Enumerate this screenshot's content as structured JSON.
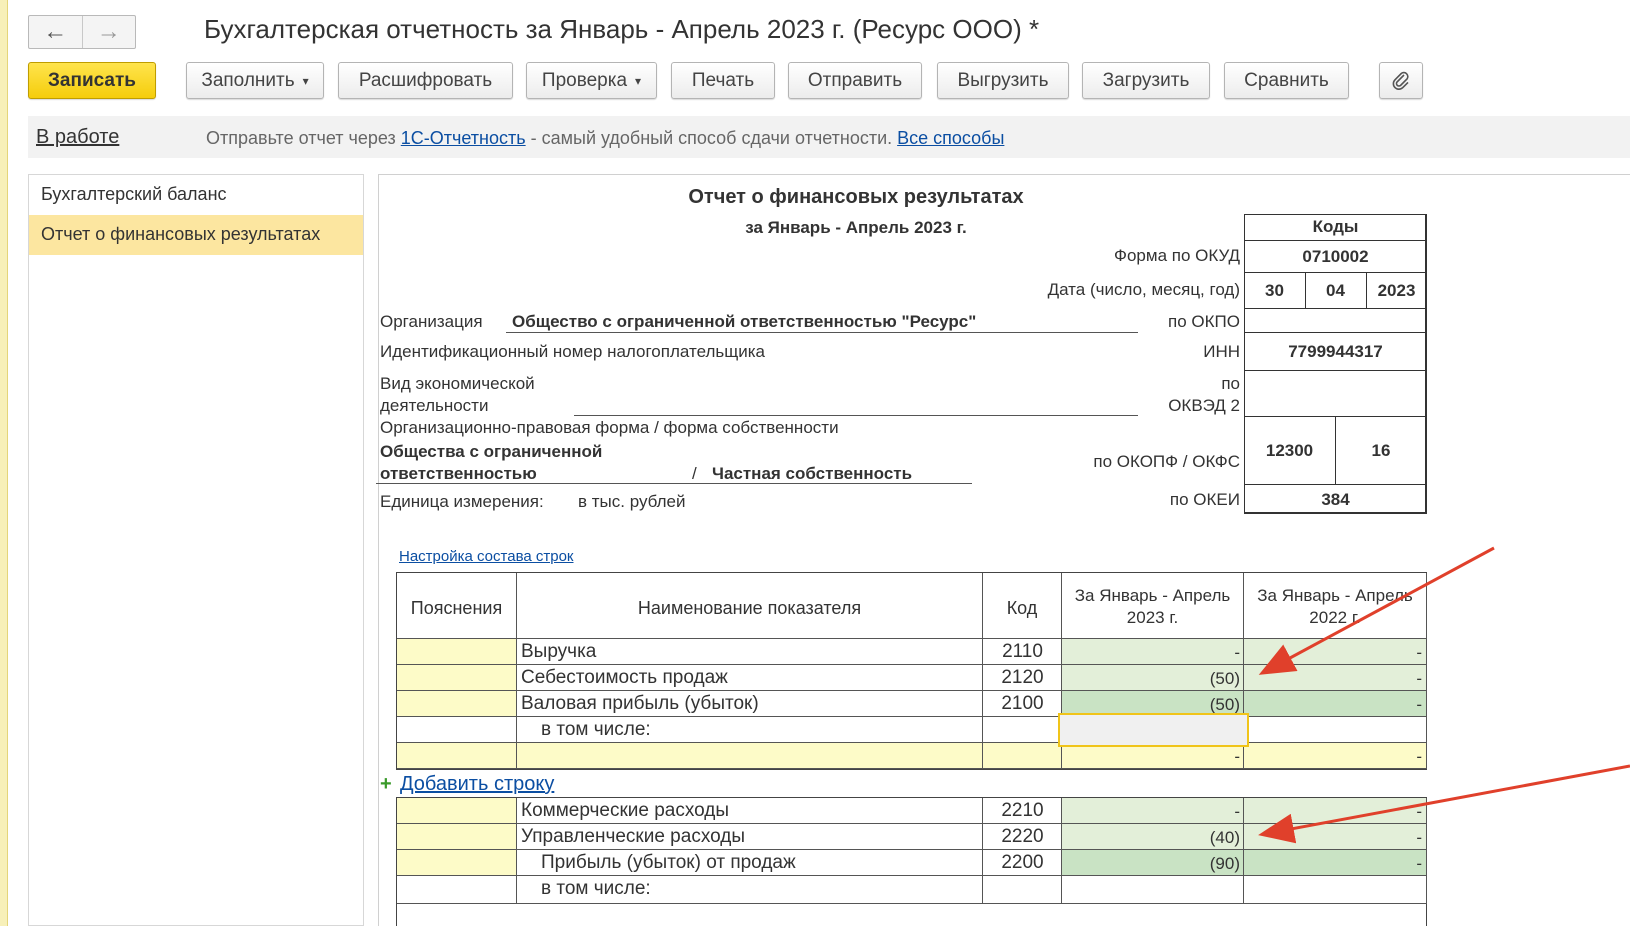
{
  "window": {
    "title": "Бухгалтерская отчетность за Январь - Апрель 2023 г. (Ресурс ООО) *",
    "back_icon": "arrow-left-icon",
    "forward_icon": "arrow-right-icon"
  },
  "toolbar": {
    "save": "Записать",
    "fill": "Заполнить",
    "decode": "Расшифровать",
    "check": "Проверка",
    "print": "Печать",
    "send": "Отправить",
    "export": "Выгрузить",
    "import": "Загрузить",
    "compare": "Сравнить",
    "attach_icon": "paperclip-icon"
  },
  "infobar": {
    "status": "В работе",
    "msg_pre": "Отправьте отчет через ",
    "msg_link": "1С-Отчетность",
    "msg_mid": " - самый удобный способ сдачи отчетности. ",
    "msg_link2": "Все способы"
  },
  "sidebar": {
    "items": [
      {
        "label": "Бухгалтерский баланс"
      },
      {
        "label": "Отчет о финансовых результатах"
      }
    ]
  },
  "report": {
    "title": "Отчет о финансовых результатах",
    "period": "за Январь - Апрель 2023 г.",
    "codes_header": "Коды",
    "okud_label": "Форма по ОКУД",
    "okud_value": "0710002",
    "date_label": "Дата (число, месяц, год)",
    "date_day": "30",
    "date_month": "04",
    "date_year": "2023",
    "org_label": "Организация",
    "org_value": "Общество с ограниченной ответственностью \"Ресурс\"",
    "okpo_label": "по ОКПО",
    "inn_label_long": "Идентификационный номер налогоплательщика",
    "inn_label": "ИНН",
    "inn_value": "7799944317",
    "activity_label_1": "Вид экономической",
    "activity_label_2": "деятельности",
    "okved_label_1": "по",
    "okved_label_2": "ОКВЭД 2",
    "opf_label": "Организационно-правовая форма / форма собственности",
    "opf_value_1": "Общества с ограниченной",
    "opf_value_2": "ответственностью",
    "opf_sep": "/",
    "ownership_value": "Частная собственность",
    "okopf_label": "по ОКОПФ / ОКФС",
    "okopf_value": "12300",
    "okfs_value": "16",
    "unit_label": "Единица измерения:",
    "unit_value": "в тыс. рублей",
    "okei_label": "по ОКЕИ",
    "okei_value": "384"
  },
  "table": {
    "settings_link": "Настройка состава строк",
    "headers": {
      "notes": "Пояснения",
      "name": "Наименование показателя",
      "code": "Код",
      "cur_1": "За Январь - Апрель",
      "cur_2": "2023 г.",
      "prev_1": "За Январь - Апрель",
      "prev_2": "2022 г."
    },
    "rows": [
      {
        "name": "Выручка",
        "code": "2110",
        "cur": "-",
        "prev": "-"
      },
      {
        "name": "Себестоимость продаж",
        "code": "2120",
        "cur": "(50)",
        "prev": "-"
      },
      {
        "name": "Валовая прибыль (убыток)",
        "code": "2100",
        "cur": "(50)",
        "prev": "-"
      },
      {
        "name": "в том числе:",
        "code": "",
        "cur": "",
        "prev": ""
      },
      {
        "name": "",
        "code": "",
        "cur": "-",
        "prev": "-"
      }
    ],
    "add_row": "Добавить строку",
    "rows2": [
      {
        "name": "Коммерческие расходы",
        "code": "2210",
        "cur": "-",
        "prev": "-"
      },
      {
        "name": "Управленческие расходы",
        "code": "2220",
        "cur": "(40)",
        "prev": "-"
      },
      {
        "name": "Прибыль (убыток) от продаж",
        "code": "2200",
        "cur": "(90)",
        "prev": "-"
      },
      {
        "name": "в том числе:",
        "code": "",
        "cur": "",
        "prev": ""
      }
    ]
  },
  "colors": {
    "accent_yellow": "#f5cd0b",
    "cell_light_green": "#e3efd9",
    "cell_green": "#c9e3c4",
    "cell_yellow": "#fdfbc8",
    "arrow_red": "#e0402b",
    "link_blue": "#0b4ea2"
  }
}
